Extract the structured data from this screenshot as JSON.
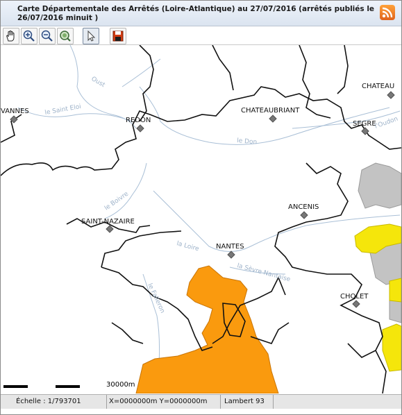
{
  "title": "Carte Départementale des Arrêtés (Loire-Atlantique) au 27/07/2016 (arrêtés publiés le 26/07/2016 minuit )",
  "toolbar": {
    "tools": [
      "pan-hand-icon",
      "zoom-in-icon",
      "zoom-out-icon",
      "zoom-extent-icon",
      "select-arrow-icon",
      "save-disk-icon"
    ]
  },
  "map": {
    "cities": [
      {
        "key": "vannes",
        "label": "VANNES"
      },
      {
        "key": "redon",
        "label": "REDON"
      },
      {
        "key": "chateaubriant",
        "label": "CHATEAUBRIANT"
      },
      {
        "key": "chateau",
        "label": "CHATEAU"
      },
      {
        "key": "segre",
        "label": "SEGRE"
      },
      {
        "key": "ancenis",
        "label": "ANCENIS"
      },
      {
        "key": "saint_nazaire",
        "label": "SAINT-NAZAIRE"
      },
      {
        "key": "nantes",
        "label": "NANTES"
      },
      {
        "key": "cholet",
        "label": "CHOLET"
      }
    ],
    "rivers": [
      "le Saint Eloi",
      "le Don",
      "le Boivre",
      "la Loire",
      "la Sèvre Nantaise",
      "le Falleron",
      "l'Oudon",
      "Oust"
    ],
    "colors": {
      "orange": "#fa9a0e",
      "yellow": "#f5e60b",
      "grey": "#c3c3c3",
      "border": "#111111",
      "river": "#a9bfd6"
    }
  },
  "scale": {
    "label": "30000m"
  },
  "status": {
    "scale": "Échelle : 1/793701",
    "coords": "X=0000000m Y=0000000m",
    "projection": "Lambert 93"
  }
}
